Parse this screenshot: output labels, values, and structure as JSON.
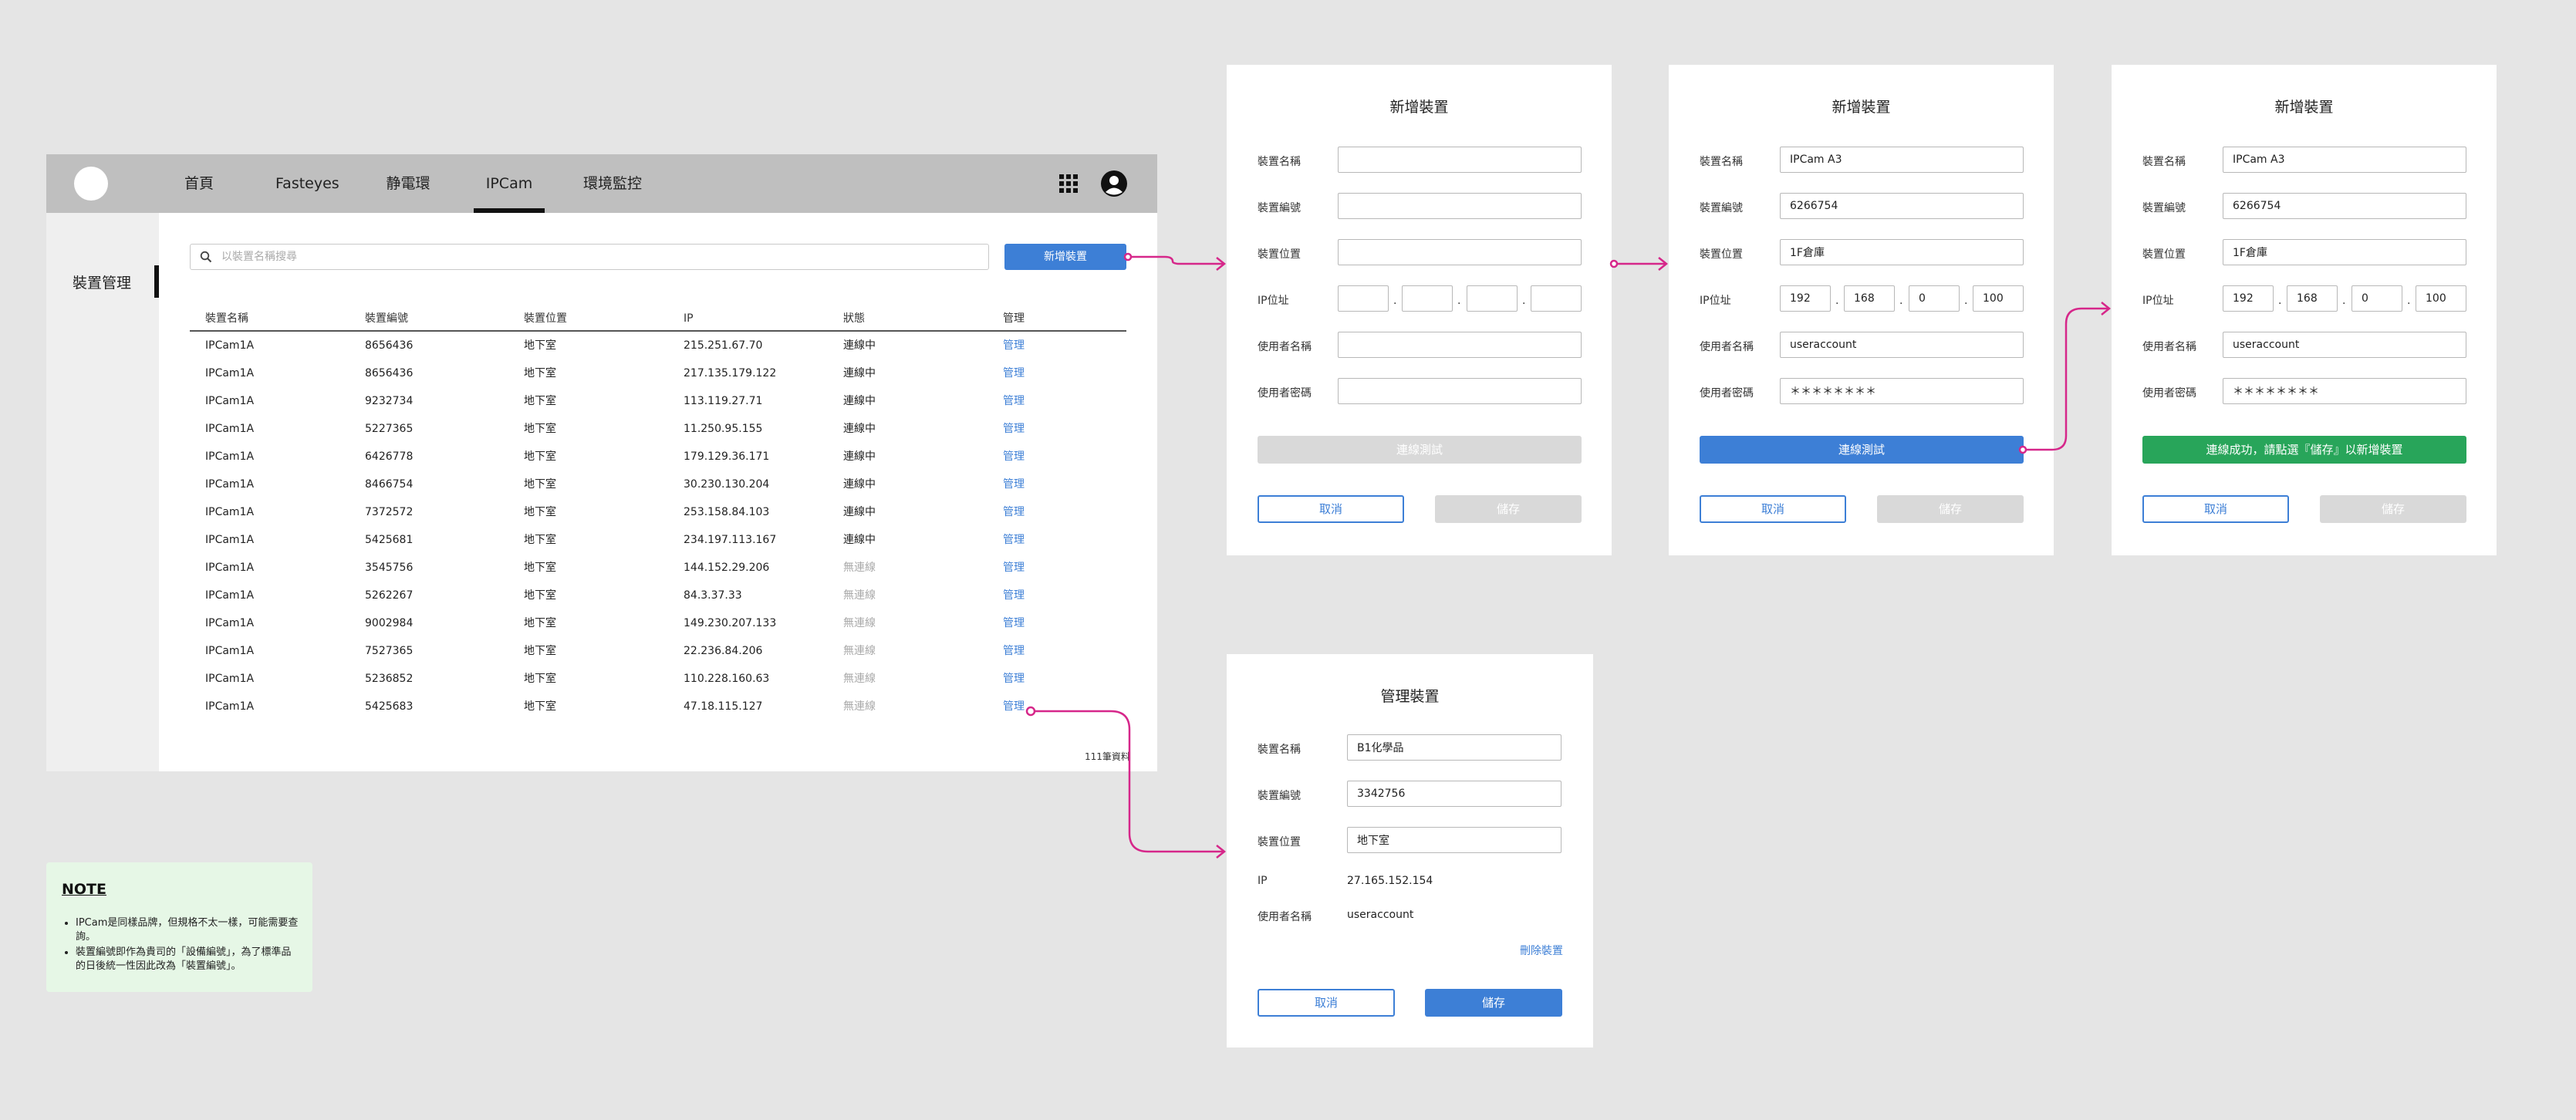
{
  "nav": {
    "items": [
      "首頁",
      "Fasteyes",
      "静電環",
      "IPCam",
      "環境監控"
    ],
    "active": "IPCam"
  },
  "sidebar": {
    "label": "裝置管理"
  },
  "search": {
    "placeholder": "以裝置名稱搜尋"
  },
  "toolbar": {
    "add_label": "新增裝置"
  },
  "table": {
    "headers": [
      "裝置名稱",
      "裝置編號",
      "裝置位置",
      "IP",
      "狀態",
      "管理"
    ],
    "rows": [
      [
        "IPCam1A",
        "8656436",
        "地下室",
        "215.251.67.70",
        "連線中",
        "管理"
      ],
      [
        "IPCam1A",
        "8656436",
        "地下室",
        "217.135.179.122",
        "連線中",
        "管理"
      ],
      [
        "IPCam1A",
        "9232734",
        "地下室",
        "113.119.27.71",
        "連線中",
        "管理"
      ],
      [
        "IPCam1A",
        "5227365",
        "地下室",
        "11.250.95.155",
        "連線中",
        "管理"
      ],
      [
        "IPCam1A",
        "6426778",
        "地下室",
        "179.129.36.171",
        "連線中",
        "管理"
      ],
      [
        "IPCam1A",
        "8466754",
        "地下室",
        "30.230.130.204",
        "連線中",
        "管理"
      ],
      [
        "IPCam1A",
        "7372572",
        "地下室",
        "253.158.84.103",
        "連線中",
        "管理"
      ],
      [
        "IPCam1A",
        "5425681",
        "地下室",
        "234.197.113.167",
        "連線中",
        "管理"
      ],
      [
        "IPCam1A",
        "3545756",
        "地下室",
        "144.152.29.206",
        "無連線",
        "管理"
      ],
      [
        "IPCam1A",
        "5262267",
        "地下室",
        "84.3.37.33",
        "無連線",
        "管理"
      ],
      [
        "IPCam1A",
        "9002984",
        "地下室",
        "149.230.207.133",
        "無連線",
        "管理"
      ],
      [
        "IPCam1A",
        "7527365",
        "地下室",
        "22.236.84.206",
        "無連線",
        "管理"
      ],
      [
        "IPCam1A",
        "5236852",
        "地下室",
        "110.228.160.63",
        "無連線",
        "管理"
      ],
      [
        "IPCam1A",
        "5425683",
        "地下室",
        "47.18.115.127",
        "無連線",
        "管理"
      ]
    ],
    "count": "111筆資料"
  },
  "note": {
    "title": "NOTE",
    "items": [
      "IPCam是同樣品牌，但規格不太一樣，可能需要查詢。",
      "裝置編號即作為貴司的「設備編號」，為了標準品的日後統一性因此改為「裝置編號」。"
    ]
  },
  "labels": {
    "name": "裝置名稱",
    "number": "裝置編號",
    "location": "裝置位置",
    "ip": "IP位址",
    "user": "使用者名稱",
    "password": "使用者密碼",
    "ip_short": "IP"
  },
  "add_empty": {
    "title": "新增裝置",
    "test": "連線測試",
    "cancel": "取消",
    "save": "儲存"
  },
  "add_filled": {
    "title": "新增裝置",
    "name": "IPCam A3",
    "number": "6266754",
    "location": "1F倉庫",
    "ip": [
      "192",
      "168",
      "0",
      "100"
    ],
    "user": "useraccount",
    "password": "＊＊＊＊＊＊＊＊",
    "test": "連線測試",
    "cancel": "取消",
    "save": "儲存"
  },
  "add_success": {
    "title": "新增裝置",
    "name": "IPCam A3",
    "number": "6266754",
    "location": "1F倉庫",
    "ip": [
      "192",
      "168",
      "0",
      "100"
    ],
    "user": "useraccount",
    "password": "＊＊＊＊＊＊＊＊",
    "status": "連線成功，請點選『儲存』以新增裝置",
    "cancel": "取消",
    "save": "儲存"
  },
  "manage": {
    "title": "管理裝置",
    "name": "B1化學品",
    "number": "3342756",
    "location": "地下室",
    "ip": "27.165.152.154",
    "user": "useraccount",
    "delete": "刪除裝置",
    "cancel": "取消",
    "save": "儲存"
  },
  "colors": {
    "primary": "#3d7fd6",
    "success": "#28a55a",
    "connector": "#d6278a",
    "topbar": "#bfbfbf",
    "note_bg": "#e6f7e6"
  }
}
